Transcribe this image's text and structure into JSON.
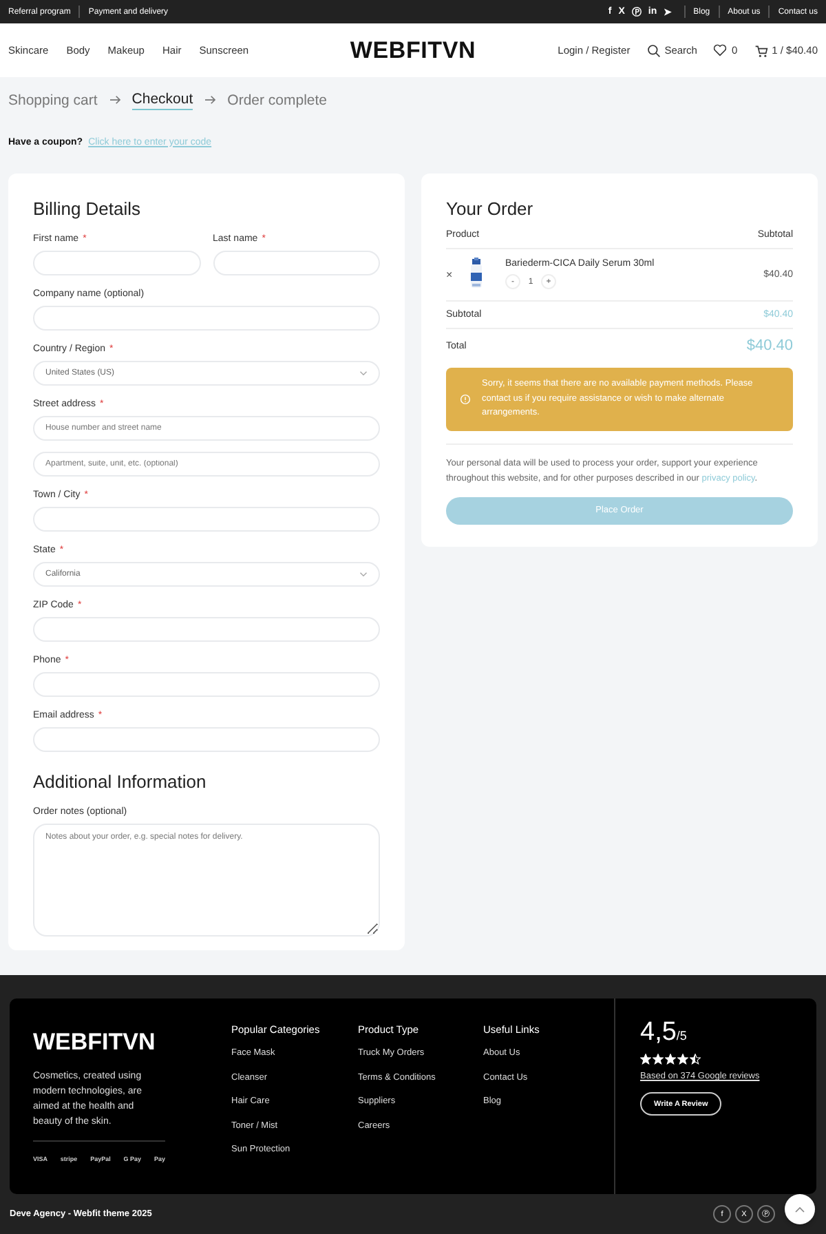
{
  "top_bar": {
    "links": [
      "Referral program",
      "Payment and delivery"
    ],
    "social": [
      "f",
      "X",
      "Ⓟ",
      "in",
      "➤"
    ],
    "right_links": [
      "Blog",
      "About us",
      "Contact us"
    ]
  },
  "header": {
    "nav": [
      "Skincare",
      "Body",
      "Makeup",
      "Hair",
      "Sunscreen"
    ],
    "logo": "WEBFITVN",
    "login": "Login / Register",
    "search": "Search",
    "wishlist_count": "0",
    "cart": "1 / $40.40"
  },
  "breadcrumb": [
    {
      "label": "Shopping cart",
      "selected": false
    },
    {
      "label": "Checkout",
      "selected": true
    },
    {
      "label": "Order complete",
      "selected": false
    }
  ],
  "coupon": {
    "text": "Have a coupon?",
    "link": "Click here to enter your code"
  },
  "billing": {
    "title": "Billing Details",
    "rows": [
      [
        {
          "label": "First name",
          "required_mark": "*",
          "kind": "input"
        },
        {
          "label": "Last name",
          "required_mark": "*",
          "kind": "input"
        }
      ],
      [
        {
          "label": "Company name (optional)",
          "kind": "input"
        }
      ],
      [
        {
          "label": "Country / Region",
          "required_mark": "*",
          "kind": "select",
          "value": "United States (US)"
        }
      ],
      [
        {
          "label": "Street address",
          "required_mark": "*",
          "kind": "input",
          "placeholder": "House number and street name"
        }
      ],
      [
        {
          "kind": "input",
          "placeholder": "Apartment, suite, unit, etc. (optional)"
        }
      ],
      [
        {
          "label": "Town / City",
          "required_mark": "*",
          "kind": "input"
        }
      ],
      [
        {
          "label": "State",
          "required_mark": "*",
          "kind": "select",
          "value": "California"
        }
      ],
      [
        {
          "label": "ZIP Code",
          "required_mark": "*",
          "kind": "input"
        }
      ],
      [
        {
          "label": "Phone",
          "required_mark": "*",
          "kind": "input"
        }
      ],
      [
        {
          "label": "Email address",
          "required_mark": "*",
          "kind": "input"
        }
      ]
    ]
  },
  "additional": {
    "title": "Additional Information",
    "label": "Order notes (optional)",
    "placeholder": "Notes about your order, e.g. special notes for delivery."
  },
  "order": {
    "title": "Your Order",
    "columns": [
      "Product",
      "Subtotal"
    ],
    "item": {
      "remove": "×",
      "name": "Bariederm-CICA Daily Serum 30ml",
      "minus": "-",
      "quantity": "1",
      "plus": "+",
      "price": "$40.40"
    },
    "subtotal": {
      "label": "Subtotal",
      "value": "$40.40"
    },
    "total": {
      "label": "Total",
      "value": "$40.40"
    },
    "notice": "Sorry, it seems that there are no available payment methods. Please contact us if you require assistance or wish to make alternate arrangements.",
    "privacy": {
      "text": "Your personal data will be used to process your order, support your experience throughout this website, and for other purposes described in our ",
      "link": "privacy policy",
      "after": "."
    },
    "button": "Place Order"
  },
  "footer": {
    "logo": "WEBFITVN",
    "description": "Cosmetics, created using modern technologies, are aimed at the health and beauty of the skin.",
    "payments": [
      "VISA",
      "stripe",
      "PayPal",
      "G Pay",
      "Pay"
    ],
    "columns": [
      {
        "title": "Popular Categories",
        "links": [
          "Face Mask",
          "Cleanser",
          "Hair Care",
          "Toner / Mist",
          "Sun Protection"
        ]
      },
      {
        "title": "Product Type",
        "links": [
          "Truck My Orders",
          "Terms & Conditions",
          "Suppliers",
          "Careers"
        ]
      },
      {
        "title": "Useful Links",
        "links": [
          "About Us",
          "Contact Us",
          "Blog"
        ]
      }
    ],
    "rating": {
      "score": "4,5",
      "out_of": "/5",
      "stars": 4.5,
      "reviews_link": "Based on 374 Google reviews",
      "button": "Write A Review"
    },
    "copyright": "Deve Agency - Webfit theme 2025",
    "social": [
      "f",
      "X",
      "Ⓟ"
    ]
  }
}
